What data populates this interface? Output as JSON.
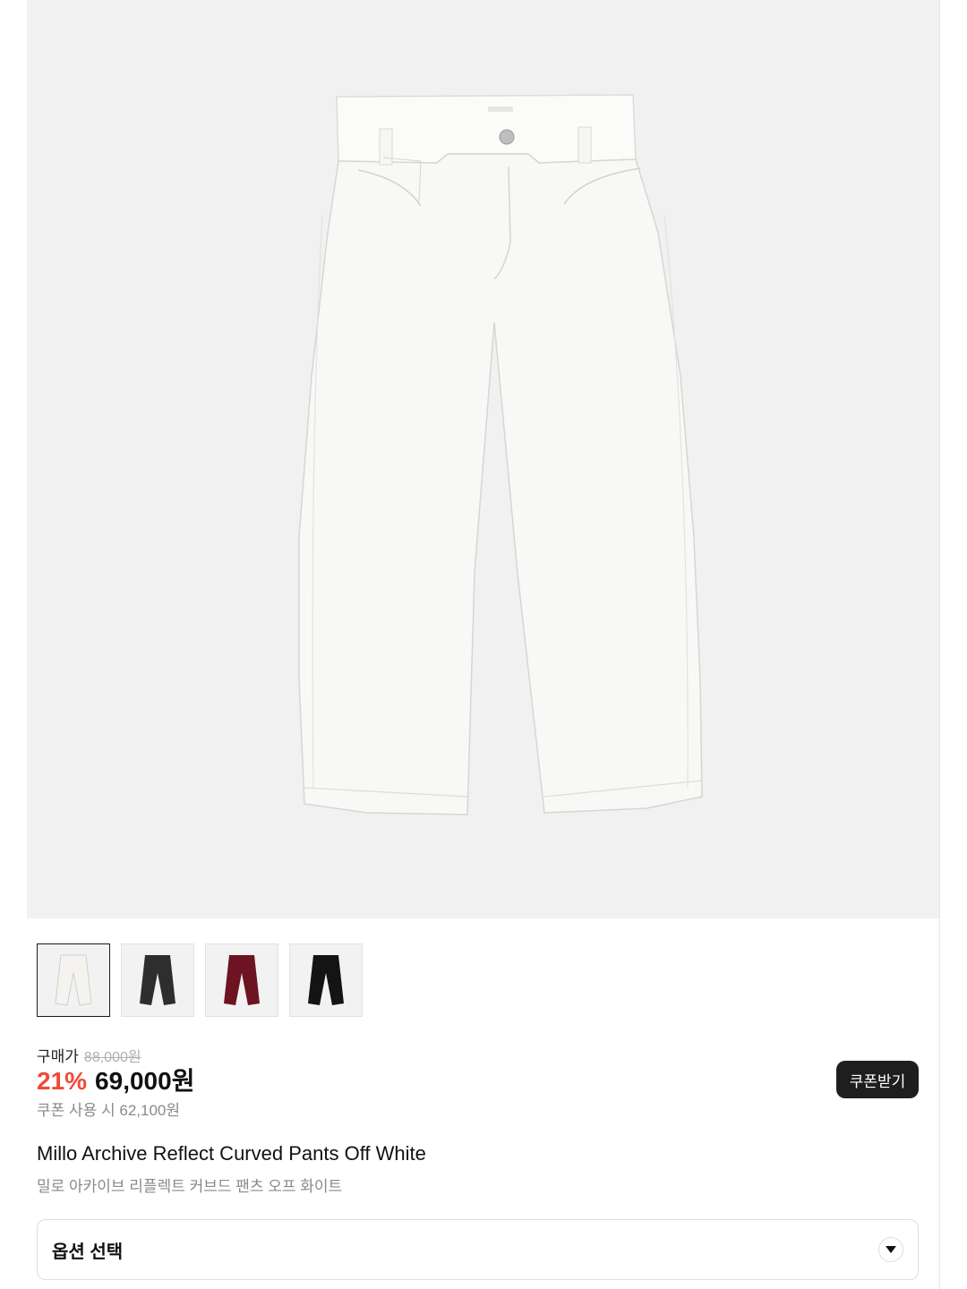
{
  "product": {
    "name_en": "Millo Archive Reflect Curved Pants Off White",
    "name_ko": "밀로 아카이브 리플렉트 커브드 팬츠 오프 화이트",
    "image_icon": "pants-product-image"
  },
  "thumbnails": [
    {
      "color_name": "off-white",
      "color": "#f4f3f0"
    },
    {
      "color_name": "charcoal",
      "color": "#2e2e2e"
    },
    {
      "color_name": "burgundy",
      "color": "#6d1322"
    },
    {
      "color_name": "black",
      "color": "#141414"
    }
  ],
  "price": {
    "buy_label": "구매가",
    "original": "88,000원",
    "discount": "21%",
    "sale": "69,000원",
    "coupon_price": "쿠폰 사용 시 62,100원"
  },
  "coupon_button": {
    "label": "쿠폰받기"
  },
  "option": {
    "label": "옵션 선택",
    "icon": "chevron-down-icon"
  },
  "colors": {
    "accent": "#ef4a37",
    "button": "#1e1e1e"
  }
}
